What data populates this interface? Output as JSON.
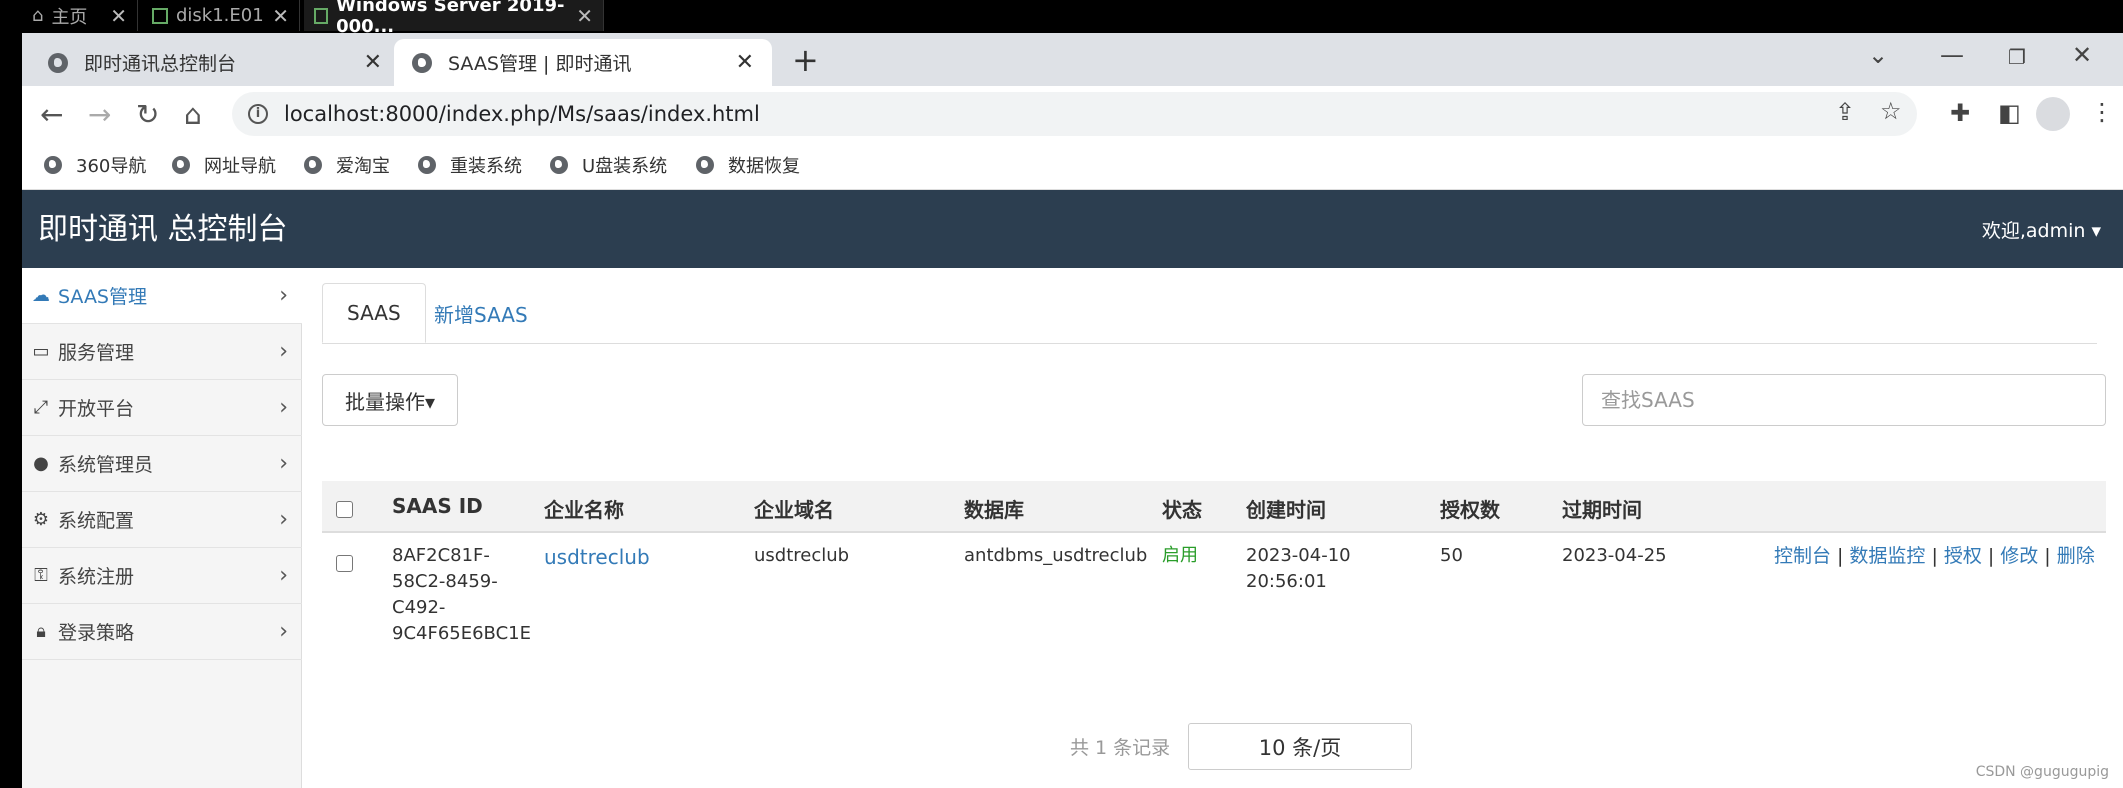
{
  "vm_tabs": [
    {
      "label": "主页",
      "close": "✕"
    },
    {
      "label": "disk1.E01",
      "close": "✕"
    },
    {
      "label": "Windows Server 2019-000...",
      "close": "✕"
    }
  ],
  "browser": {
    "tabs": [
      {
        "title": "即时通讯总控制台",
        "close": "✕"
      },
      {
        "title": "SAAS管理 | 即时通讯",
        "close": "✕"
      }
    ],
    "new_tab": "+",
    "url": "localhost:8000/index.php/Ms/saas/index.html",
    "bookmarks": [
      "360导航",
      "网址导航",
      "爱淘宝",
      "重装系统",
      "U盘装系统",
      "数据恢复"
    ]
  },
  "app": {
    "title": "即时通讯 总控制台",
    "welcome": "欢迎,admin ▾"
  },
  "sidebar": {
    "items": [
      {
        "label": "SAAS管理",
        "icon": "cloud-icon"
      },
      {
        "label": "服务管理",
        "icon": "monitor-icon"
      },
      {
        "label": "开放平台",
        "icon": "expand-icon"
      },
      {
        "label": "系统管理员",
        "icon": "user-icon"
      },
      {
        "label": "系统配置",
        "icon": "gear-icon"
      },
      {
        "label": "系统注册",
        "icon": "key-icon"
      },
      {
        "label": "登录策略",
        "icon": "lock-icon"
      }
    ]
  },
  "main": {
    "tabs": [
      "SAAS",
      "新增SAAS"
    ],
    "batch_label": "批量操作▾",
    "search_placeholder": "查找SAAS",
    "columns": [
      "SAAS ID",
      "企业名称",
      "企业域名",
      "数据库",
      "状态",
      "创建时间",
      "授权数",
      "过期时间"
    ],
    "rows": [
      {
        "id_lines": [
          "8AF2C81F-",
          "58C2-8459-",
          "C492-",
          "9C4F65E6BC1E"
        ],
        "name": "usdtreclub",
        "domain": "usdtreclub",
        "db": "antdbms_usdtreclub",
        "status": "启用",
        "created_lines": [
          "2023-04-10",
          "20:56:01"
        ],
        "licenses": "50",
        "expires": "2023-04-25",
        "actions": [
          "控制台",
          "数据监控",
          "授权",
          "修改",
          "删除"
        ]
      }
    ],
    "pager_total": "共 1 条记录",
    "page_size": "10 条/页"
  },
  "watermark": "CSDN @gugugupig",
  "colors": {
    "header_bg": "#2c3e50",
    "link": "#337ab7",
    "status_green": "#2a9d2a"
  }
}
